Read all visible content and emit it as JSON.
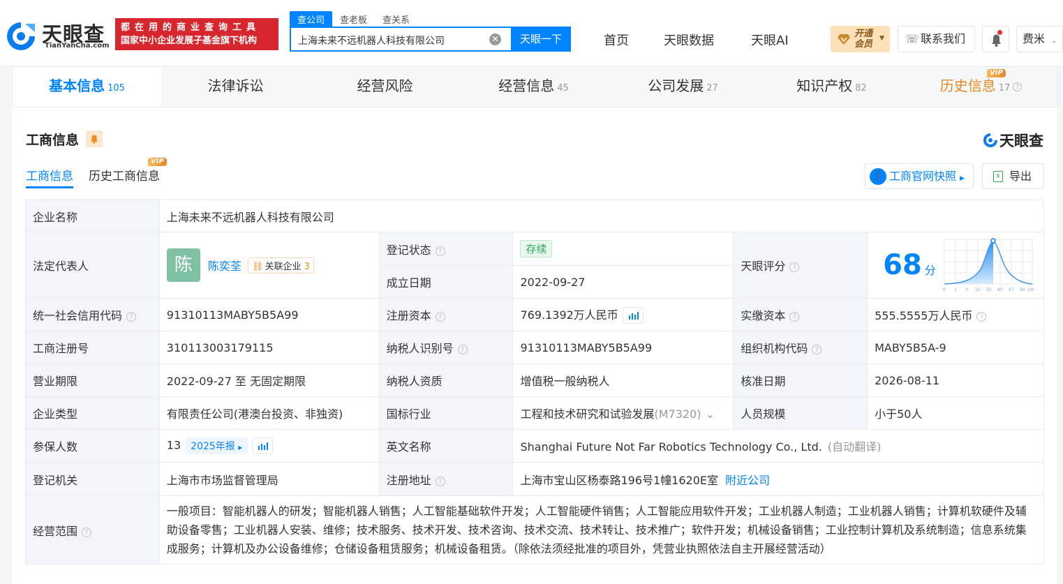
{
  "header": {
    "logo_cn": "天眼查",
    "logo_en": "TianYanCha.com",
    "slogan_line1": "都在用的商业查询工具",
    "slogan_line2": "国家中小企业发展子基金旗下机构",
    "search_tabs": [
      "查公司",
      "查老板",
      "查关系"
    ],
    "search_query": "上海未来不远机器人科技有限公司",
    "search_button": "天眼一下",
    "nav": [
      "首页",
      "天眼数据",
      "天眼AI"
    ],
    "vip_open_line1": "开通",
    "vip_open_line2": "会员",
    "contact": "联系我们",
    "user": "费米"
  },
  "tabs": [
    {
      "label": "基本信息",
      "count": "105"
    },
    {
      "label": "法律诉讼",
      "count": ""
    },
    {
      "label": "经营风险",
      "count": ""
    },
    {
      "label": "经营信息",
      "count": "45"
    },
    {
      "label": "公司发展",
      "count": "27"
    },
    {
      "label": "知识产权",
      "count": "82"
    },
    {
      "label": "历史信息",
      "count": "17"
    }
  ],
  "vip_tag": "VIP",
  "section": {
    "title": "工商信息",
    "brand": "天眼查",
    "subtabs": [
      "工商信息",
      "历史工商信息"
    ],
    "snapshot_btn": "工商官网快照",
    "export_btn": "导出"
  },
  "info": {
    "company_name_k": "企业名称",
    "company_name_v": "上海未来不远机器人科技有限公司",
    "legal_rep_k": "法定代表人",
    "legal_rep_avatar": "陈",
    "legal_rep_v": "陈奕荃",
    "related_label": "关联企业",
    "related_count": "3",
    "reg_status_k": "登记状态",
    "reg_status_v": "存续",
    "est_date_k": "成立日期",
    "est_date_v": "2022-09-27",
    "score_k": "天眼评分",
    "score_v": "68",
    "score_unit": "分",
    "score_axis": [
      "0",
      "1",
      "3",
      "15",
      "50",
      "85",
      "97",
      "99",
      "100"
    ],
    "credit_code_k": "统一社会信用代码",
    "credit_code_v": "91310113MABY5B5A99",
    "reg_capital_k": "注册资本",
    "reg_capital_v": "769.1392万人民币",
    "paid_capital_k": "实缴资本",
    "paid_capital_v": "555.5555万人民币",
    "reg_no_k": "工商注册号",
    "reg_no_v": "310113003179115",
    "taxpayer_id_k": "纳税人识别号",
    "taxpayer_id_v": "91310113MABY5B5A99",
    "org_code_k": "组织机构代码",
    "org_code_v": "MABY5B5A-9",
    "term_k": "营业期限",
    "term_v": "2022-09-27 至 无固定期限",
    "taxpayer_q_k": "纳税人资质",
    "taxpayer_q_v": "增值税一般纳税人",
    "approve_date_k": "核准日期",
    "approve_date_v": "2026-08-11",
    "type_k": "企业类型",
    "type_v": "有限责任公司(港澳台投资、非独资)",
    "industry_k": "国标行业",
    "industry_v": "工程和技术研究和试验发展",
    "industry_code": "(M7320)",
    "staff_k": "人员规模",
    "staff_v": "小于50人",
    "insured_k": "参保人数",
    "insured_v": "13",
    "insured_report": "2025年报",
    "en_name_k": "英文名称",
    "en_name_v": "Shanghai Future Not Far Robotics Technology Co., Ltd.",
    "en_name_note": "(自动翻译)",
    "authority_k": "登记机关",
    "authority_v": "上海市市场监督管理局",
    "address_k": "注册地址",
    "address_v": "上海市宝山区杨泰路196号1幢1620E室",
    "nearby": "附近公司",
    "scope_k": "经营范围",
    "scope_v": "一般项目：智能机器人的研发；智能机器人销售；人工智能基础软件开发；人工智能硬件销售；人工智能应用软件开发；工业机器人制造；工业机器人销售；计算机软硬件及辅助设备零售；工业机器人安装、维修；技术服务、技术开发、技术咨询、技术交流、技术转让、技术推广；软件开发；机械设备销售；工业控制计算机及系统制造；信息系统集成服务；计算机及办公设备维修；仓储设备租赁服务；机械设备租赁。（除依法须经批准的项目外，凭营业执照依法自主开展经营活动）"
  },
  "colors": {
    "accent": "#0084ff",
    "vip": "#e08a1e",
    "status_green": "#2fa660",
    "slogan_red": "#d7262d"
  }
}
